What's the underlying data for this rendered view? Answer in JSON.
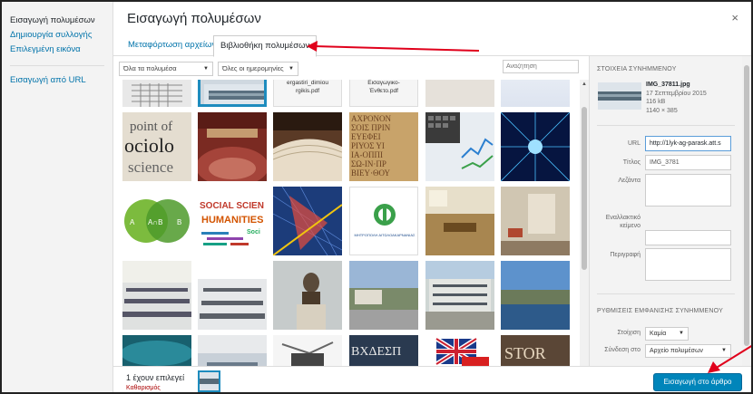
{
  "menu": {
    "items": [
      {
        "label": "Εισαγωγή πολυμέσων",
        "active": true
      },
      {
        "label": "Δημιουργία συλλογής"
      },
      {
        "label": "Επιλεγμένη εικόνα"
      },
      {
        "label": "Εισαγωγή από URL"
      }
    ]
  },
  "modal": {
    "title": "Εισαγωγή πολυμέσων",
    "close_icon": "×"
  },
  "tabs": {
    "upload": "Μεταφόρτωση αρχείων",
    "library": "Βιβλιοθήκη πολυμέσων"
  },
  "filters": {
    "type": "Όλα τα πολυμέσα",
    "date": "Όλες οι ημερομηνίες",
    "search_placeholder": "Αναζήτηση"
  },
  "grid": {
    "docs": [
      {
        "name": "ergastiri_dimioyrgikis.pdf",
        "line1": "ergastiri_dimiou",
        "line2": "rgikis.pdf"
      },
      {
        "name": "Εισαγωγικό-Ένθετο.pdf",
        "line1": "Εισαγωγικο-",
        "line2": "Ένθετο.pdf"
      }
    ],
    "text_images": {
      "sociology": [
        "point of",
        "ociolo",
        "science"
      ],
      "social": [
        "SOCIAL SCIEN",
        "HUMANITIES",
        "Soci"
      ],
      "venn": [
        "A",
        "A∩B",
        "B"
      ],
      "book": "STOR",
      "greek_text": [
        "ΑΧΡΟΝΟΝ",
        "ΣΟΙΣ ΠΡΙΝ",
        "ΕΥΕΦΕΙ",
        "ΡΙΥΟΣ ΥΙ",
        "ΙΑ-ΟΠΠΙ",
        "ΣΩ-ΙΝ·ΠΡ",
        "ΒΙΕΥ·ΘΟΥ"
      ],
      "keyboard": "ΒΧΔΕΣΠ"
    },
    "seal_text": "ΜΗΤΡΟΠΟΛΗ ΑΙΤΩΛΟΑΚΑΡΝΑΝΙΑΣ"
  },
  "attachment": {
    "heading": "ΣΤΟΙΧΕΙΑ ΣΥΝΗΜΜΕΝΟΥ",
    "filename": "IMG_37811.jpg",
    "date": "17 Σεπτεμβρίου 2015",
    "size": "116 kB",
    "dimensions": "1140 × 385",
    "url_label": "URL",
    "url_value": "http://1lyk-ag-parask.att.s",
    "title_label": "Τίτλος",
    "title_value": "IMG_3781",
    "caption_label": "Λεζάντα",
    "alt_label_1": "Εναλλακτικό",
    "alt_label_2": "κείμενο",
    "desc_label": "Περιγραφή"
  },
  "display": {
    "heading": "ΡΥΘΜΙΣΕΙΣ ΕΜΦΑΝΙΣΗΣ ΣΥΝΗΜΜΕΝΟΥ",
    "align_label": "Στοίχιση",
    "align_value": "Καμία",
    "link_label": "Σύνδεση στο",
    "link_value": "Αρχείο πολυμέσων"
  },
  "footer": {
    "count": "1 έχουν επιλεγεί",
    "clear": "Καθαρισμός",
    "insert": "Εισαγωγή στο άρθρο"
  },
  "colors": {
    "accent": "#0073aa",
    "button": "#0085ba",
    "selected_border": "#1e8cbe",
    "annotation_arrow": "#e0001b"
  }
}
